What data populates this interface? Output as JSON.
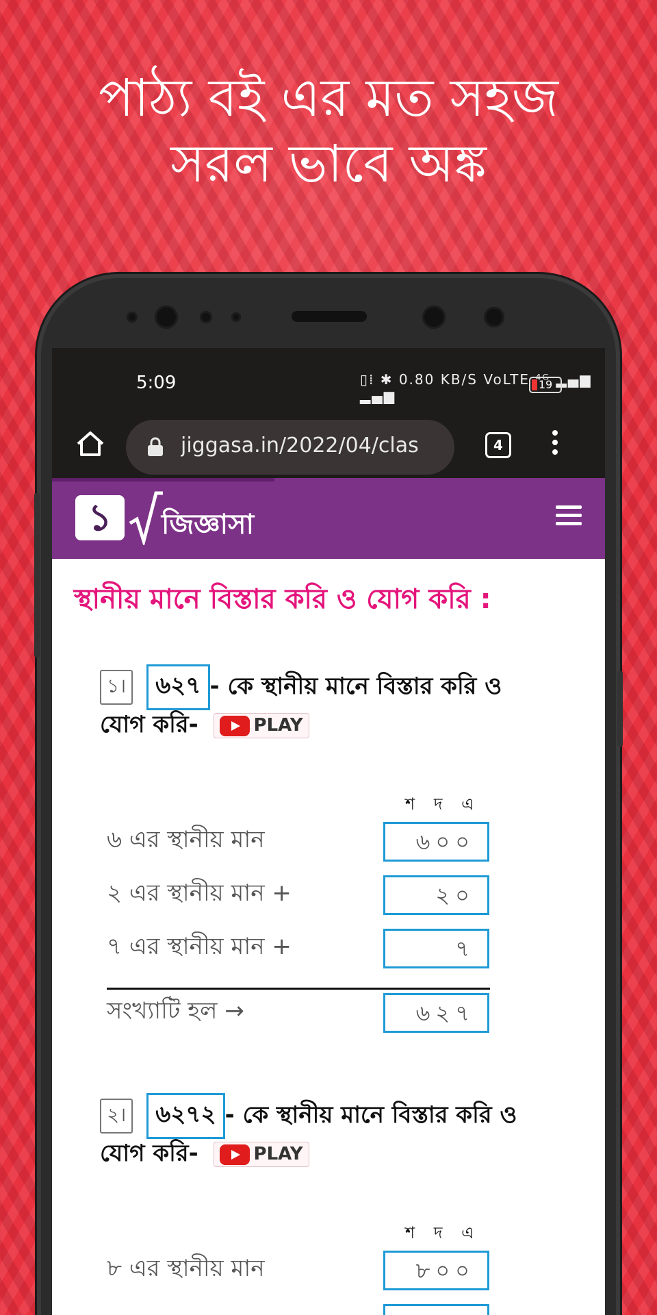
{
  "headline": {
    "line1": "পাঠ্য বই এর মত সহজ",
    "line2": "সরল ভাবে অঙ্ক"
  },
  "status_bar": {
    "time": "5:09",
    "icons_text": "▯⁞ ✱ 0.80 KB/S VoLTE ⁴ᴳ ▂▄▆ ▂▄▆",
    "battery": "19"
  },
  "browser": {
    "url": "jiggasa.in/2022/04/clas",
    "tab_count": "4"
  },
  "site": {
    "logo_mark": "১",
    "logo_text": "জিজ্ঞাসা"
  },
  "page": {
    "title": "স্থানীয় মানে বিস্তার করি ও যোগ করি :",
    "play_label": "PLAY",
    "place_header": "শ দ এ",
    "questions": [
      {
        "num": "১।",
        "number": "৬২৭",
        "text_line1": "- কে স্থানীয় মানে বিস্তার করি ও",
        "text_line2": "যোগ করি-",
        "rows": [
          {
            "label": "৬ এর স্থানীয় মান",
            "value": "৬০০"
          },
          {
            "label": "২ এর স্থানীয় মান  +",
            "value": "২০"
          },
          {
            "label": "৭ এর স্থানীয় মান  +",
            "value": "৭"
          }
        ],
        "result_label": "সংখ্যাটি হল →",
        "result_value": "৬২৭"
      },
      {
        "num": "২।",
        "number": "৬২৭২",
        "text_line1": "- কে স্থানীয় মানে বিস্তার করি ও",
        "text_line2": "যোগ করি-",
        "rows": [
          {
            "label": "৮ এর স্থানীয় মান",
            "value": "৮০০"
          }
        ]
      }
    ]
  },
  "colors": {
    "background_red": "#e8323f",
    "site_purple": "#7c3287",
    "title_pink": "#e4157c",
    "box_blue": "#1e9ad6"
  }
}
